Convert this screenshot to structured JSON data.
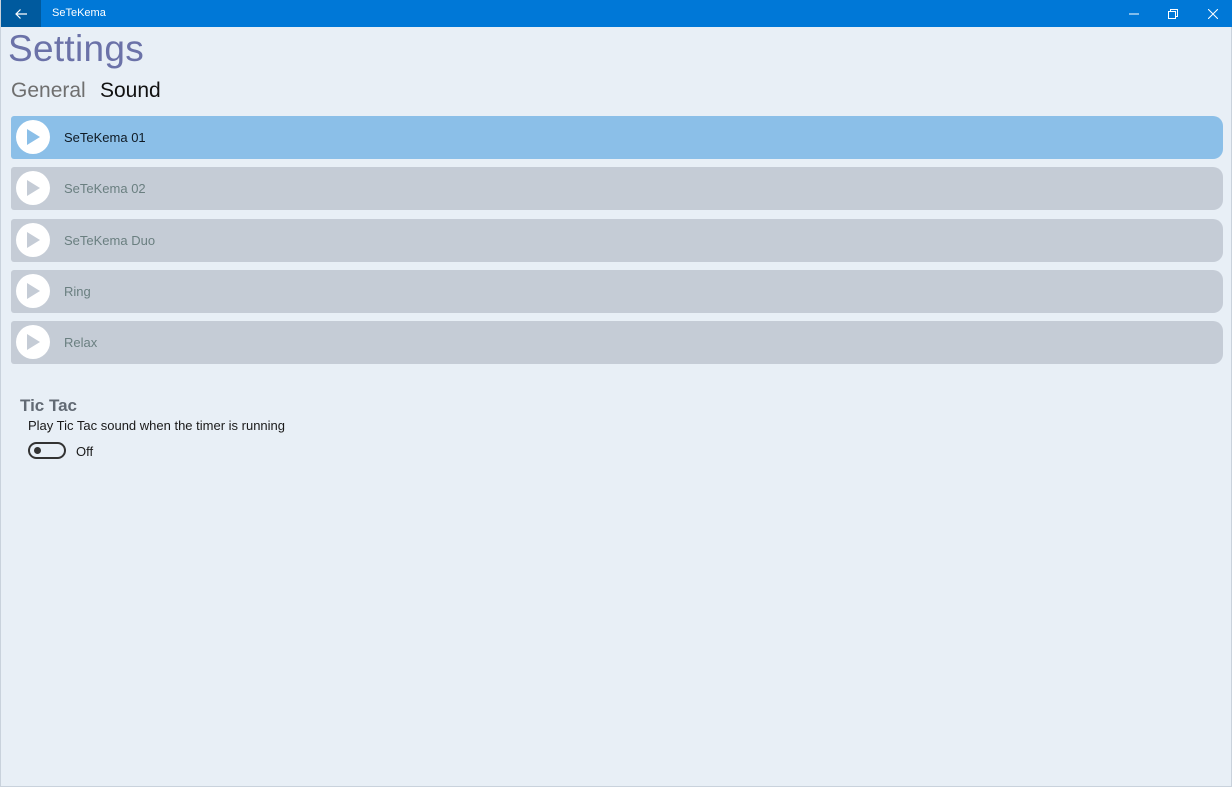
{
  "window": {
    "app_title": "SeTeKema"
  },
  "page": {
    "title": "Settings",
    "tabs": [
      {
        "label": "General",
        "selected": false
      },
      {
        "label": "Sound",
        "selected": true
      }
    ]
  },
  "sounds": [
    {
      "label": "SeTeKema 01",
      "selected": true
    },
    {
      "label": "SeTeKema 02",
      "selected": false
    },
    {
      "label": "SeTeKema Duo",
      "selected": false
    },
    {
      "label": "Ring",
      "selected": false
    },
    {
      "label": "Relax",
      "selected": false
    }
  ],
  "tictac": {
    "title": "Tic Tac",
    "description": "Play Tic Tac sound when the timer is running",
    "toggle_state": "Off"
  },
  "colors": {
    "titlebar": "#0078d7",
    "back_button": "#005a9e",
    "selected_item": "#8bbfe8",
    "item": "#c5ccd6",
    "page_title": "#6b72a8",
    "background": "#e8eff6"
  },
  "icons": {
    "back": "arrow-left-icon",
    "minimize": "minimize-icon",
    "maximize": "restore-icon",
    "close": "close-icon",
    "play": "play-icon"
  }
}
